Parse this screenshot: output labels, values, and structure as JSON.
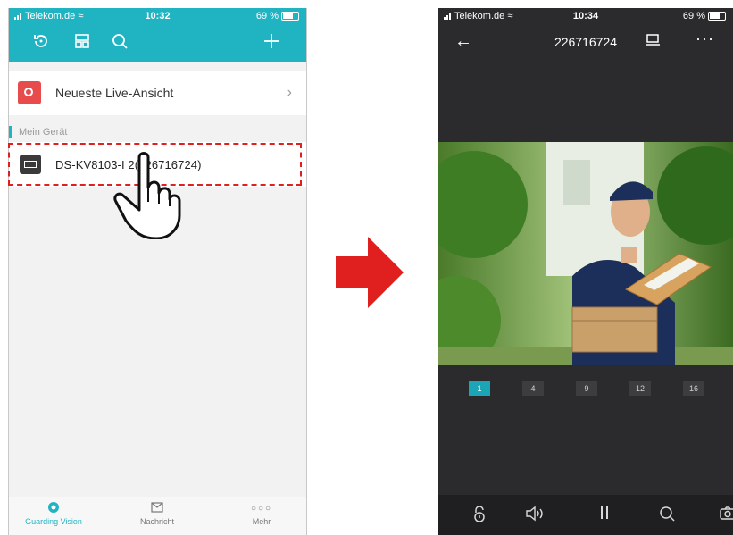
{
  "left_phone": {
    "status": {
      "carrier": "Telekom.de",
      "time": "10:32",
      "battery": "69 %"
    },
    "toolbar": {
      "icons": [
        "refresh-icon",
        "layout-icon",
        "search-icon",
        "add-icon"
      ]
    },
    "live_view": {
      "label": "Neueste Live-Ansicht",
      "chevron": "›"
    },
    "section": {
      "label": "Mein Gerät"
    },
    "device": {
      "label": "DS-KV8103-I  2(226716724)"
    },
    "nav": [
      {
        "label": "Guarding Vision",
        "icon": "guarding-icon"
      },
      {
        "label": "Nachricht",
        "icon": "mail-icon"
      },
      {
        "label": "Mehr",
        "icon": "more-icon"
      }
    ]
  },
  "right_phone": {
    "status": {
      "carrier": "Telekom.de",
      "time": "10:34",
      "battery": "69 %"
    },
    "header": {
      "back": "←",
      "title": "226716724",
      "more": "···"
    },
    "pages": [
      "1",
      "4",
      "9",
      "12",
      "16"
    ],
    "active_page": "1",
    "controls": [
      "unlock-icon",
      "speaker-icon",
      "pause-icon",
      "search-icon",
      "camera-icon"
    ]
  },
  "colors": {
    "accent": "#20b4c3",
    "alert": "#e0201f",
    "dark": "#2b2b2d"
  }
}
